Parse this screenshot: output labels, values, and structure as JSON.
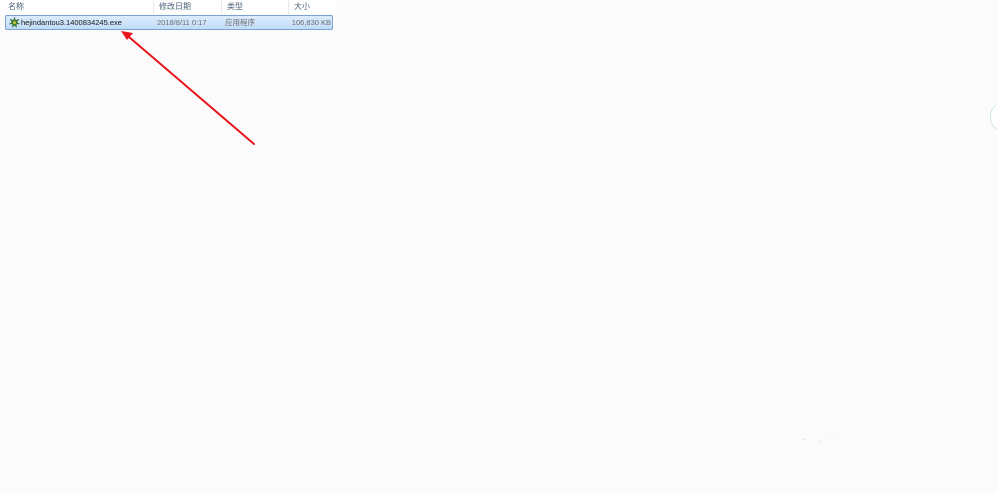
{
  "columns": {
    "name": "名称",
    "date_modified": "修改日期",
    "type": "类型",
    "size": "大小"
  },
  "files": [
    {
      "name": "hejindantou3.1400834245.exe",
      "date_modified": "2018/8/11 0:17",
      "type": "应用程序",
      "size": "106,830 KB",
      "icon": "green-leaf-app-icon",
      "selected": true
    }
  ],
  "annotation": {
    "arrow_color": "#e8141b",
    "arrow_icon": "red-arrow-icon"
  },
  "colors": {
    "selection_fill": "#cce3fb",
    "selection_border": "#7da2ce",
    "header_text": "#4c607a"
  }
}
